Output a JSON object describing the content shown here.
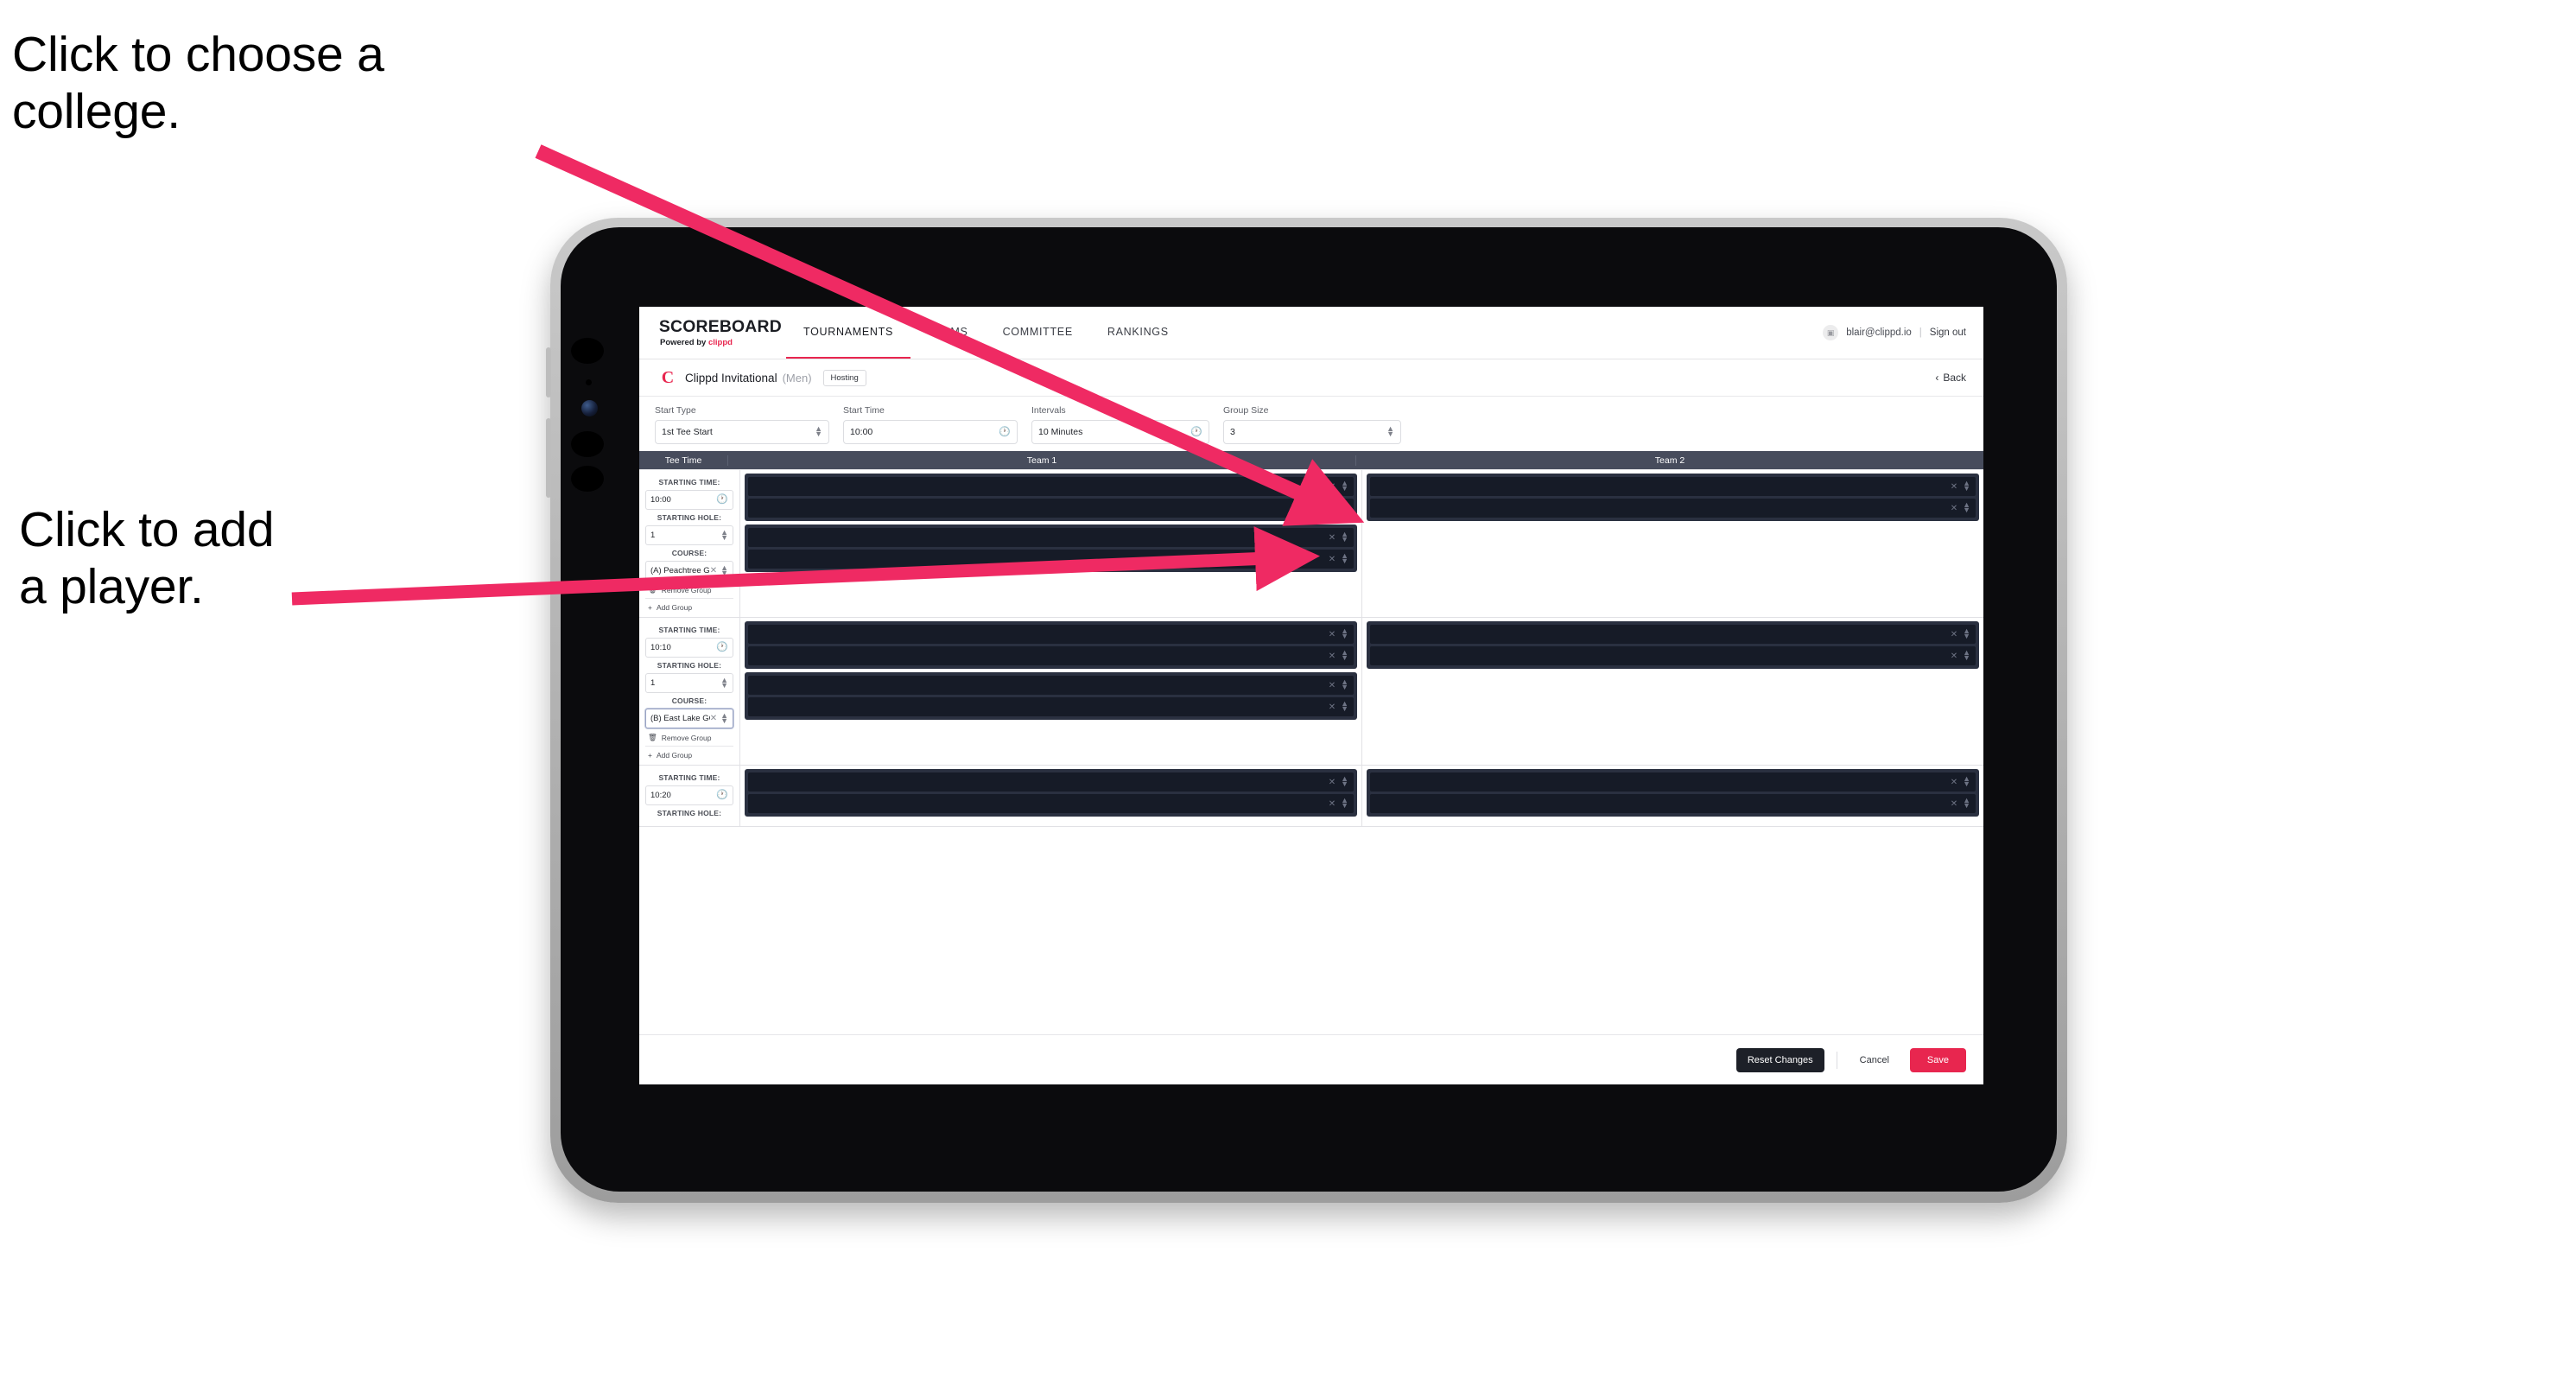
{
  "annotations": [
    {
      "id": "a1",
      "text": "Click to choose a\ncollege."
    },
    {
      "id": "a2",
      "text": "Click to add\na player."
    }
  ],
  "colors": {
    "accent_pink": "#e8264f",
    "nav_header_bg": "#474c5c",
    "slot_card_bg": "#2a3040",
    "slot_row_bg": "#161b27",
    "dark_button": "#1d2028"
  },
  "app": {
    "brand": {
      "wordmark": "SCOREBOARD",
      "powered_prefix": "Powered by ",
      "powered_brand": "clippd"
    },
    "tabs": [
      {
        "label": "TOURNAMENTS",
        "active": true
      },
      {
        "label": "TEAMS",
        "active": false
      },
      {
        "label": "COMMITTEE",
        "active": false
      },
      {
        "label": "RANKINGS",
        "active": false
      }
    ],
    "account": {
      "avatar_icon": "user-card-icon",
      "email": "blair@clippd.io",
      "separator": "|",
      "sign_out": "Sign out"
    },
    "tournament_bar": {
      "logo_letter": "C",
      "name": "Clippd Invitational",
      "gender": "(Men)",
      "badge": "Hosting",
      "back_chevron": "‹",
      "back_label": "Back"
    },
    "controls": [
      {
        "label": "Start Type",
        "value": "1st Tee Start",
        "icon": "stepper-icon",
        "has_clear": false
      },
      {
        "label": "Start Time",
        "value": "10:00",
        "icon": "clock-icon",
        "has_clear": false
      },
      {
        "label": "Intervals",
        "value": "10 Minutes",
        "icon": "clock-icon",
        "has_clear": false
      },
      {
        "label": "Group Size",
        "value": "3",
        "icon": "stepper-icon",
        "has_clear": false
      }
    ],
    "table": {
      "headers": {
        "tee_time": "Tee Time",
        "team_1": "Team 1",
        "team_2": "Team 2"
      },
      "labels": {
        "starting_time": "STARTING TIME:",
        "starting_hole": "STARTING HOLE:",
        "course": "COURSE:",
        "remove_group": "Remove Group",
        "add_group": "Add Group",
        "remove_icon": "trash-icon",
        "add_icon": "plus-icon",
        "clear_icon": "close-x-icon",
        "stepper_icon": "stepper-icon",
        "clock_icon": "clock-icon"
      },
      "groups": [
        {
          "starting_time": "10:00",
          "starting_hole": "1",
          "course": "(A) Peachtree GC",
          "course_focused": false,
          "team1_cards": [
            2,
            2
          ],
          "team2_cards": [
            2
          ]
        },
        {
          "starting_time": "10:10",
          "starting_hole": "1",
          "course": "(B) East Lake GC",
          "course_focused": true,
          "team1_cards": [
            2,
            2
          ],
          "team2_cards": [
            2
          ]
        },
        {
          "starting_time": "10:20",
          "starting_hole": "",
          "course": "",
          "course_focused": false,
          "team1_cards": [
            2
          ],
          "team2_cards": [
            2
          ]
        }
      ]
    },
    "footer": {
      "reset": "Reset Changes",
      "cancel": "Cancel",
      "save": "Save"
    }
  }
}
